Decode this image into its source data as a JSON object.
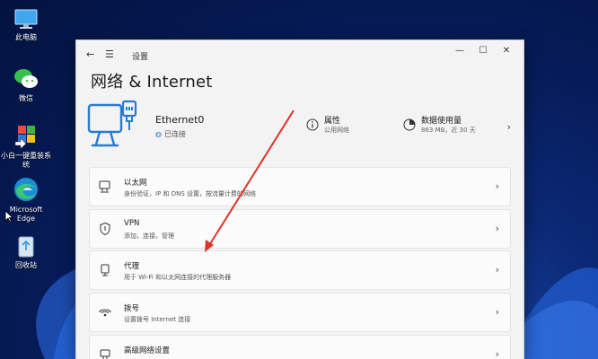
{
  "desktop": {
    "icons": [
      {
        "label": "此电脑",
        "icon": "computer-icon"
      },
      {
        "label": "微信",
        "icon": "wechat-icon"
      },
      {
        "label": "小白一键重装系统",
        "icon": "reinstall-tool-icon"
      },
      {
        "label": "Microsoft Edge",
        "icon": "edge-icon"
      },
      {
        "label": "回收站",
        "icon": "recycle-bin-icon"
      }
    ]
  },
  "window": {
    "title": "设置",
    "back": "←",
    "menu": "☰",
    "minimize": "—",
    "maximize": "☐",
    "close": "✕"
  },
  "page": {
    "title": "网络 & Internet"
  },
  "hero": {
    "adapter_name": "Ethernet0",
    "status": "已连接",
    "properties": {
      "title": "属性",
      "subtitle": "公用网络",
      "icon": "info-icon"
    },
    "data_usage": {
      "title": "数据使用量",
      "subtitle": "863 MB，近 30 天",
      "icon": "data-usage-icon"
    }
  },
  "rows": [
    {
      "title": "以太网",
      "subtitle": "身份验证，IP 和 DNS 设置，按流量计费的网络",
      "icon": "ethernet-icon"
    },
    {
      "title": "VPN",
      "subtitle": "添加，连接，管理",
      "icon": "vpn-shield-icon"
    },
    {
      "title": "代理",
      "subtitle": "用于 Wi-Fi 和以太网连接的代理服务器",
      "icon": "proxy-icon"
    },
    {
      "title": "拨号",
      "subtitle": "设置拨号 Internet 连接",
      "icon": "dialup-icon"
    },
    {
      "title": "高级网络设置",
      "subtitle": "",
      "icon": "advanced-network-icon"
    }
  ],
  "colors": {
    "accent": "#2a7ad5",
    "annotation_arrow": "#e0332a",
    "window_bg": "#f3f3f3"
  }
}
